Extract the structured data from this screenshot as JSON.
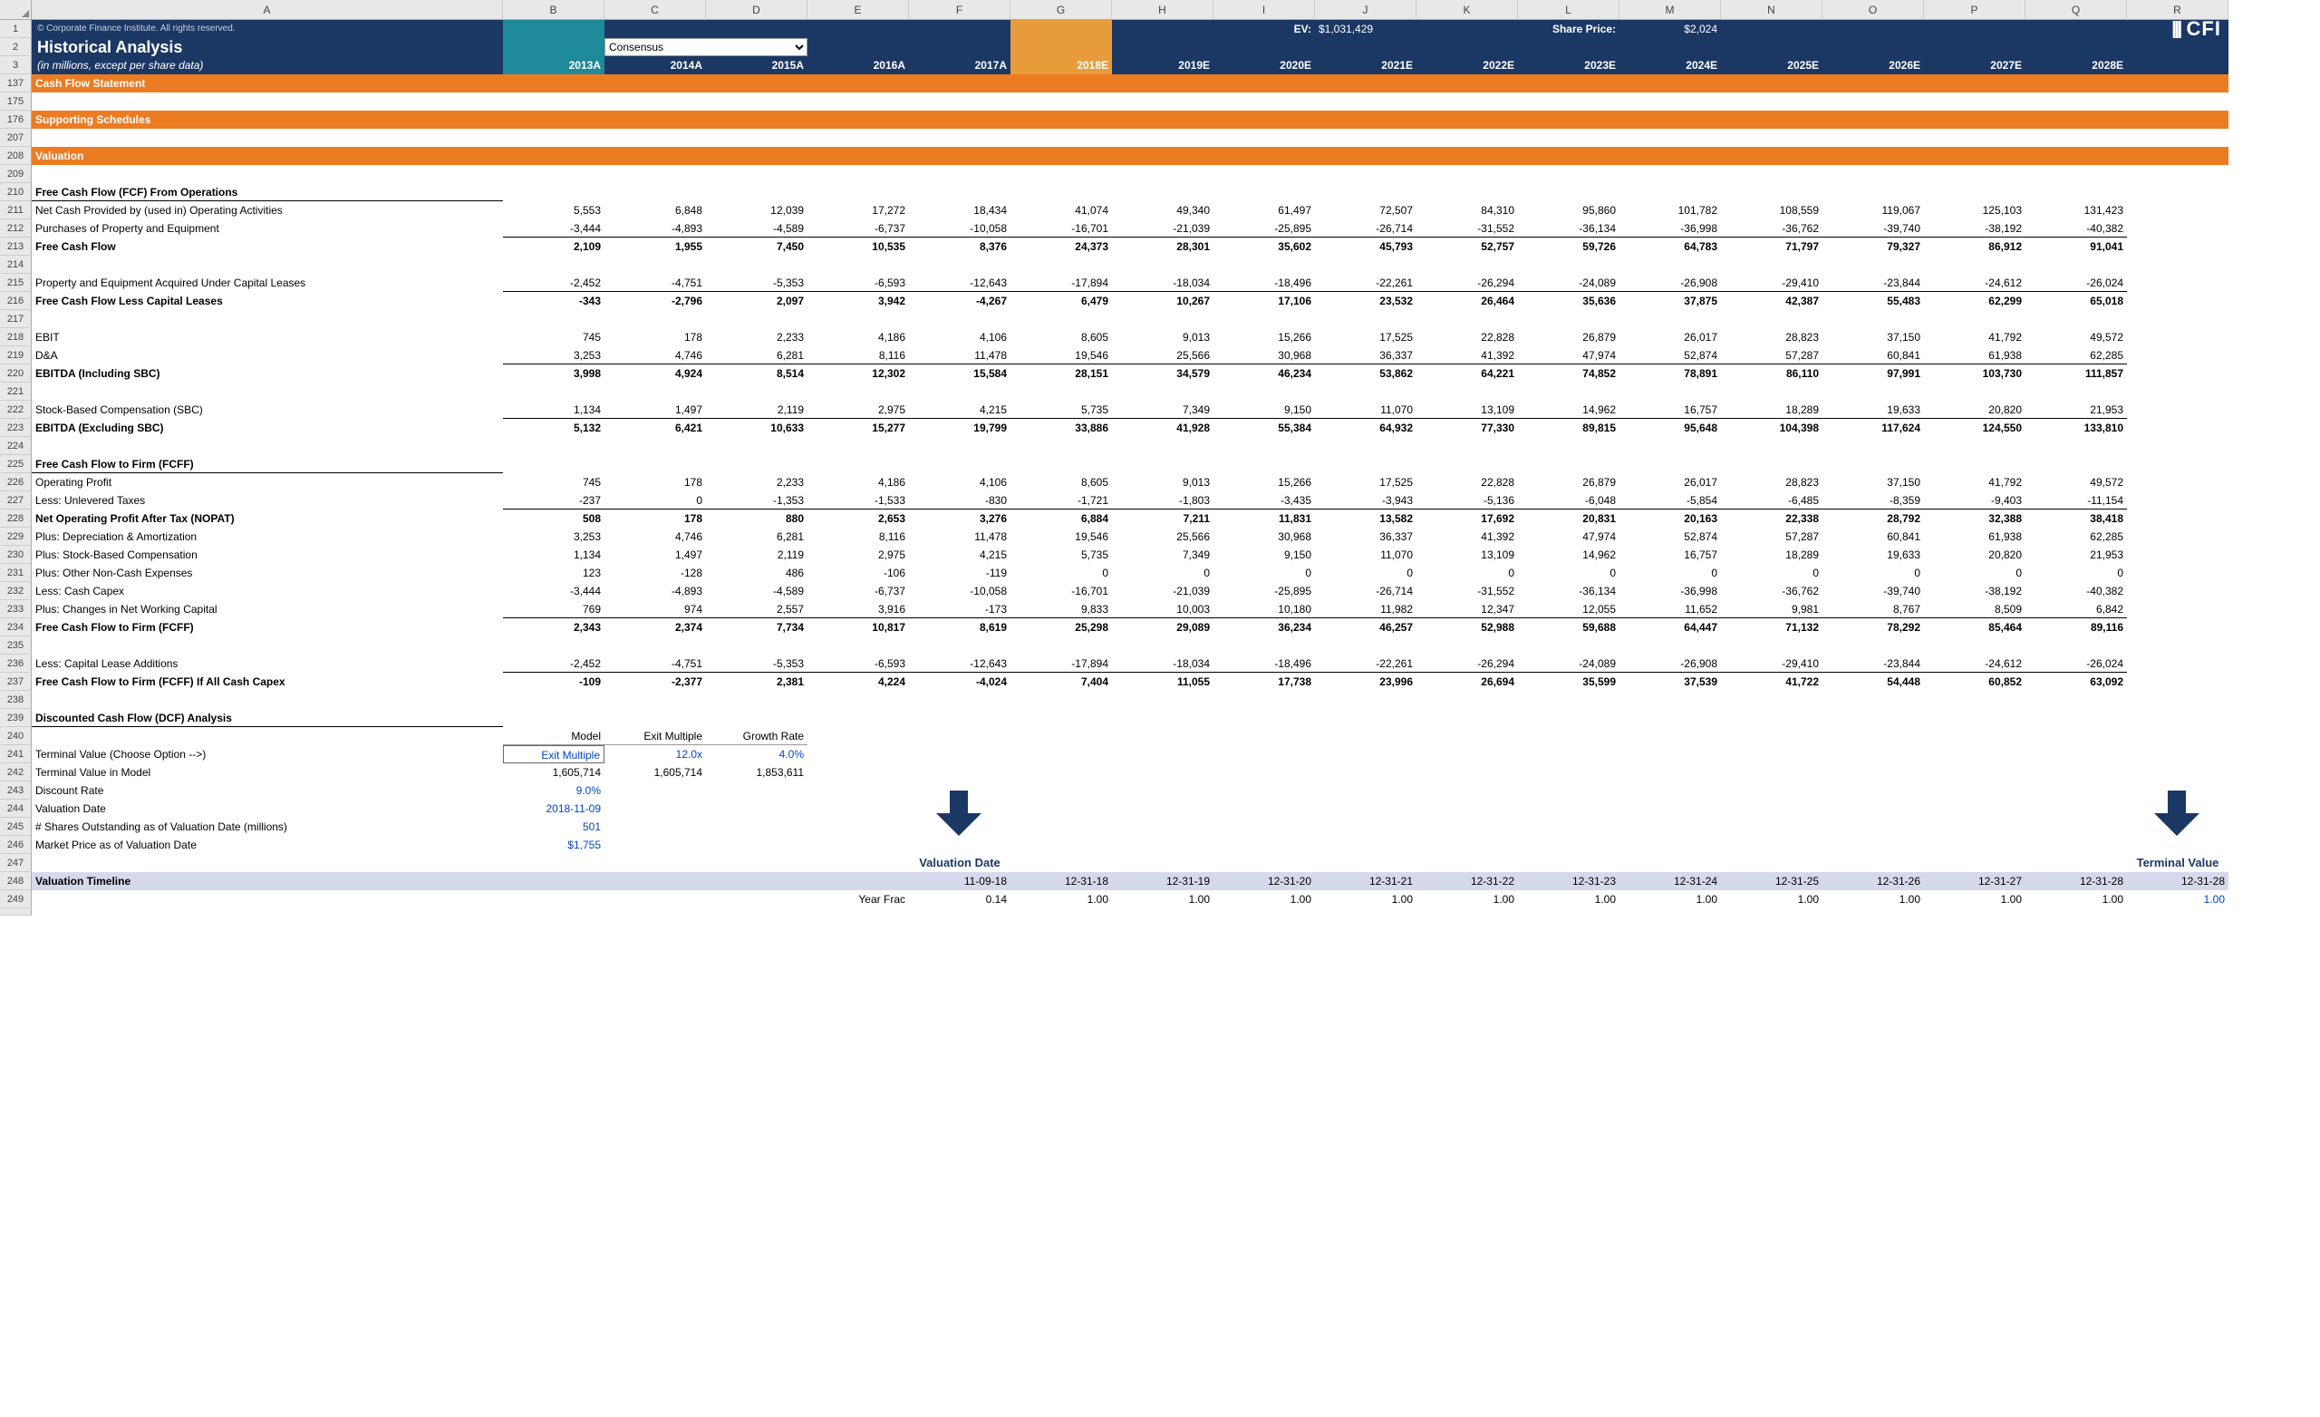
{
  "columns": [
    "",
    "A",
    "B",
    "C",
    "D",
    "E",
    "F",
    "G",
    "H",
    "I",
    "J",
    "K",
    "L",
    "M",
    "N",
    "O",
    "P",
    "Q",
    "R"
  ],
  "header": {
    "copyright": "© Corporate Finance Institute. All rights reserved.",
    "title": "Historical Analysis",
    "subtitle": "(in millions, except per share data)",
    "dropdown": "Consensus",
    "ev_label": "EV:",
    "ev_val": "$1,031,429",
    "sp_label": "Share Price:",
    "sp_val": "$2,024",
    "logo": "CFI",
    "years": [
      "2013A",
      "2014A",
      "2015A",
      "2016A",
      "2017A",
      "2018E",
      "2019E",
      "2020E",
      "2021E",
      "2022E",
      "2023E",
      "2024E",
      "2025E",
      "2026E",
      "2027E",
      "2028E"
    ]
  },
  "sections": {
    "cfs": "Cash Flow Statement",
    "ss": "Supporting Schedules",
    "val": "Valuation"
  },
  "rows": [
    {
      "n": 210,
      "label": "Free Cash Flow (FCF) From Operations",
      "style": "sec-und"
    },
    {
      "n": 211,
      "label": "Net Cash Provided by (used in) Operating Activities",
      "v": [
        "5,553",
        "6,848",
        "12,039",
        "17,272",
        "18,434",
        "41,074",
        "49,340",
        "61,497",
        "72,507",
        "84,310",
        "95,860",
        "101,782",
        "108,559",
        "119,067",
        "125,103",
        "131,423"
      ]
    },
    {
      "n": 212,
      "label": "Purchases of Property and Equipment",
      "v": [
        "-3,444",
        "-4,893",
        "-4,589",
        "-6,737",
        "-10,058",
        "-16,701",
        "-21,039",
        "-25,895",
        "-26,714",
        "-31,552",
        "-36,134",
        "-36,998",
        "-36,762",
        "-39,740",
        "-38,192",
        "-40,382"
      ],
      "ul": true
    },
    {
      "n": 213,
      "label": "Free Cash Flow",
      "v": [
        "2,109",
        "1,955",
        "7,450",
        "10,535",
        "8,376",
        "24,373",
        "28,301",
        "35,602",
        "45,793",
        "52,757",
        "59,726",
        "64,783",
        "71,797",
        "79,327",
        "86,912",
        "91,041"
      ],
      "b": true
    },
    {
      "n": 214,
      "blank": true
    },
    {
      "n": 215,
      "label": "Property and Equipment Acquired Under Capital Leases",
      "v": [
        "-2,452",
        "-4,751",
        "-5,353",
        "-6,593",
        "-12,643",
        "-17,894",
        "-18,034",
        "-18,496",
        "-22,261",
        "-26,294",
        "-24,089",
        "-26,908",
        "-29,410",
        "-23,844",
        "-24,612",
        "-26,024"
      ],
      "ul": true
    },
    {
      "n": 216,
      "label": "Free Cash Flow Less Capital Leases",
      "v": [
        "-343",
        "-2,796",
        "2,097",
        "3,942",
        "-4,267",
        "6,479",
        "10,267",
        "17,106",
        "23,532",
        "26,464",
        "35,636",
        "37,875",
        "42,387",
        "55,483",
        "62,299",
        "65,018"
      ],
      "b": true
    },
    {
      "n": 217,
      "blank": true
    },
    {
      "n": 218,
      "label": "EBIT",
      "v": [
        "745",
        "178",
        "2,233",
        "4,186",
        "4,106",
        "8,605",
        "9,013",
        "15,266",
        "17,525",
        "22,828",
        "26,879",
        "26,017",
        "28,823",
        "37,150",
        "41,792",
        "49,572"
      ]
    },
    {
      "n": 219,
      "label": "D&A",
      "v": [
        "3,253",
        "4,746",
        "6,281",
        "8,116",
        "11,478",
        "19,546",
        "25,566",
        "30,968",
        "36,337",
        "41,392",
        "47,974",
        "52,874",
        "57,287",
        "60,841",
        "61,938",
        "62,285"
      ],
      "ul": true
    },
    {
      "n": 220,
      "label": "EBITDA (Including SBC)",
      "v": [
        "3,998",
        "4,924",
        "8,514",
        "12,302",
        "15,584",
        "28,151",
        "34,579",
        "46,234",
        "53,862",
        "64,221",
        "74,852",
        "78,891",
        "86,110",
        "97,991",
        "103,730",
        "111,857"
      ],
      "b": true
    },
    {
      "n": 221,
      "blank": true
    },
    {
      "n": 222,
      "label": "Stock-Based Compensation (SBC)",
      "v": [
        "1,134",
        "1,497",
        "2,119",
        "2,975",
        "4,215",
        "5,735",
        "7,349",
        "9,150",
        "11,070",
        "13,109",
        "14,962",
        "16,757",
        "18,289",
        "19,633",
        "20,820",
        "21,953"
      ],
      "ul": true
    },
    {
      "n": 223,
      "label": "EBITDA (Excluding SBC)",
      "v": [
        "5,132",
        "6,421",
        "10,633",
        "15,277",
        "19,799",
        "33,886",
        "41,928",
        "55,384",
        "64,932",
        "77,330",
        "89,815",
        "95,648",
        "104,398",
        "117,624",
        "124,550",
        "133,810"
      ],
      "b": true
    },
    {
      "n": 224,
      "blank": true
    },
    {
      "n": 225,
      "label": "Free Cash Flow to Firm (FCFF)",
      "style": "sec-und"
    },
    {
      "n": 226,
      "label": "Operating Profit",
      "v": [
        "745",
        "178",
        "2,233",
        "4,186",
        "4,106",
        "8,605",
        "9,013",
        "15,266",
        "17,525",
        "22,828",
        "26,879",
        "26,017",
        "28,823",
        "37,150",
        "41,792",
        "49,572"
      ]
    },
    {
      "n": 227,
      "label": "Less: Unlevered Taxes",
      "v": [
        "-237",
        "0",
        "-1,353",
        "-1,533",
        "-830",
        "-1,721",
        "-1,803",
        "-3,435",
        "-3,943",
        "-5,136",
        "-6,048",
        "-5,854",
        "-6,485",
        "-8,359",
        "-9,403",
        "-11,154"
      ],
      "ul": true
    },
    {
      "n": 228,
      "label": "Net Operating Profit After Tax (NOPAT)",
      "v": [
        "508",
        "178",
        "880",
        "2,653",
        "3,276",
        "6,884",
        "7,211",
        "11,831",
        "13,582",
        "17,692",
        "20,831",
        "20,163",
        "22,338",
        "28,792",
        "32,388",
        "38,418"
      ],
      "b": true
    },
    {
      "n": 229,
      "label": "Plus: Depreciation & Amortization",
      "v": [
        "3,253",
        "4,746",
        "6,281",
        "8,116",
        "11,478",
        "19,546",
        "25,566",
        "30,968",
        "36,337",
        "41,392",
        "47,974",
        "52,874",
        "57,287",
        "60,841",
        "61,938",
        "62,285"
      ]
    },
    {
      "n": 230,
      "label": "Plus: Stock-Based Compensation",
      "v": [
        "1,134",
        "1,497",
        "2,119",
        "2,975",
        "4,215",
        "5,735",
        "7,349",
        "9,150",
        "11,070",
        "13,109",
        "14,962",
        "16,757",
        "18,289",
        "19,633",
        "20,820",
        "21,953"
      ]
    },
    {
      "n": 231,
      "label": "Plus: Other Non-Cash Expenses",
      "v": [
        "123",
        "-128",
        "486",
        "-106",
        "-119",
        "0",
        "0",
        "0",
        "0",
        "0",
        "0",
        "0",
        "0",
        "0",
        "0",
        "0"
      ]
    },
    {
      "n": 232,
      "label": "Less: Cash Capex",
      "v": [
        "-3,444",
        "-4,893",
        "-4,589",
        "-6,737",
        "-10,058",
        "-16,701",
        "-21,039",
        "-25,895",
        "-26,714",
        "-31,552",
        "-36,134",
        "-36,998",
        "-36,762",
        "-39,740",
        "-38,192",
        "-40,382"
      ]
    },
    {
      "n": 233,
      "label": "Plus: Changes in Net Working Capital",
      "v": [
        "769",
        "974",
        "2,557",
        "3,916",
        "-173",
        "9,833",
        "10,003",
        "10,180",
        "11,982",
        "12,347",
        "12,055",
        "11,652",
        "9,981",
        "8,767",
        "8,509",
        "6,842"
      ],
      "ul": true
    },
    {
      "n": 234,
      "label": "Free Cash Flow to Firm (FCFF)",
      "v": [
        "2,343",
        "2,374",
        "7,734",
        "10,817",
        "8,619",
        "25,298",
        "29,089",
        "36,234",
        "46,257",
        "52,988",
        "59,688",
        "64,447",
        "71,132",
        "78,292",
        "85,464",
        "89,116"
      ],
      "b": true
    },
    {
      "n": 235,
      "blank": true
    },
    {
      "n": 236,
      "label": "Less: Capital Lease Additions",
      "v": [
        "-2,452",
        "-4,751",
        "-5,353",
        "-6,593",
        "-12,643",
        "-17,894",
        "-18,034",
        "-18,496",
        "-22,261",
        "-26,294",
        "-24,089",
        "-26,908",
        "-29,410",
        "-23,844",
        "-24,612",
        "-26,024"
      ],
      "ul": true
    },
    {
      "n": 237,
      "label": "Free Cash Flow to Firm (FCFF) If All Cash Capex",
      "v": [
        "-109",
        "-2,377",
        "2,381",
        "4,224",
        "-4,024",
        "7,404",
        "11,055",
        "17,738",
        "23,996",
        "26,694",
        "35,599",
        "37,539",
        "41,722",
        "54,448",
        "60,852",
        "63,092"
      ],
      "b": true
    },
    {
      "n": 238,
      "blank": true
    },
    {
      "n": 239,
      "label": "Discounted Cash Flow (DCF) Analysis",
      "style": "sec-und"
    }
  ],
  "dcf": {
    "cols": [
      "Model",
      "Exit Multiple",
      "Growth Rate"
    ],
    "rows": [
      {
        "n": 241,
        "label": "Terminal Value (Choose Option -->)",
        "v": [
          "Exit Multiple",
          "12.0x",
          "4.0%"
        ],
        "box0": true
      },
      {
        "n": 242,
        "label": "Terminal Value in Model",
        "v": [
          "1,605,714",
          "1,605,714",
          "1,853,611"
        ]
      },
      {
        "n": 243,
        "label": "Discount Rate",
        "v": [
          "9.0%",
          "",
          ""
        ]
      },
      {
        "n": 244,
        "label": "Valuation Date",
        "v": [
          "2018-11-09",
          "",
          ""
        ]
      },
      {
        "n": 245,
        "label": "# Shares Outstanding as of Valuation Date (millions)",
        "v": [
          "501",
          "",
          ""
        ]
      },
      {
        "n": 246,
        "label": "Market Price as of Valuation Date",
        "v": [
          "$1,755",
          "",
          ""
        ]
      }
    ]
  },
  "arrows": {
    "vd": "Valuation Date",
    "tv": "Terminal Value"
  },
  "timeline": {
    "label": "Valuation Timeline",
    "dates": [
      "11-09-18",
      "12-31-18",
      "12-31-19",
      "12-31-20",
      "12-31-21",
      "12-31-22",
      "12-31-23",
      "12-31-24",
      "12-31-25",
      "12-31-26",
      "12-31-27",
      "12-31-28",
      "12-31-28"
    ],
    "yf_label": "Year Frac",
    "yf": [
      "0.14",
      "1.00",
      "1.00",
      "1.00",
      "1.00",
      "1.00",
      "1.00",
      "1.00",
      "1.00",
      "1.00",
      "1.00",
      "1.00",
      "1.00"
    ]
  }
}
